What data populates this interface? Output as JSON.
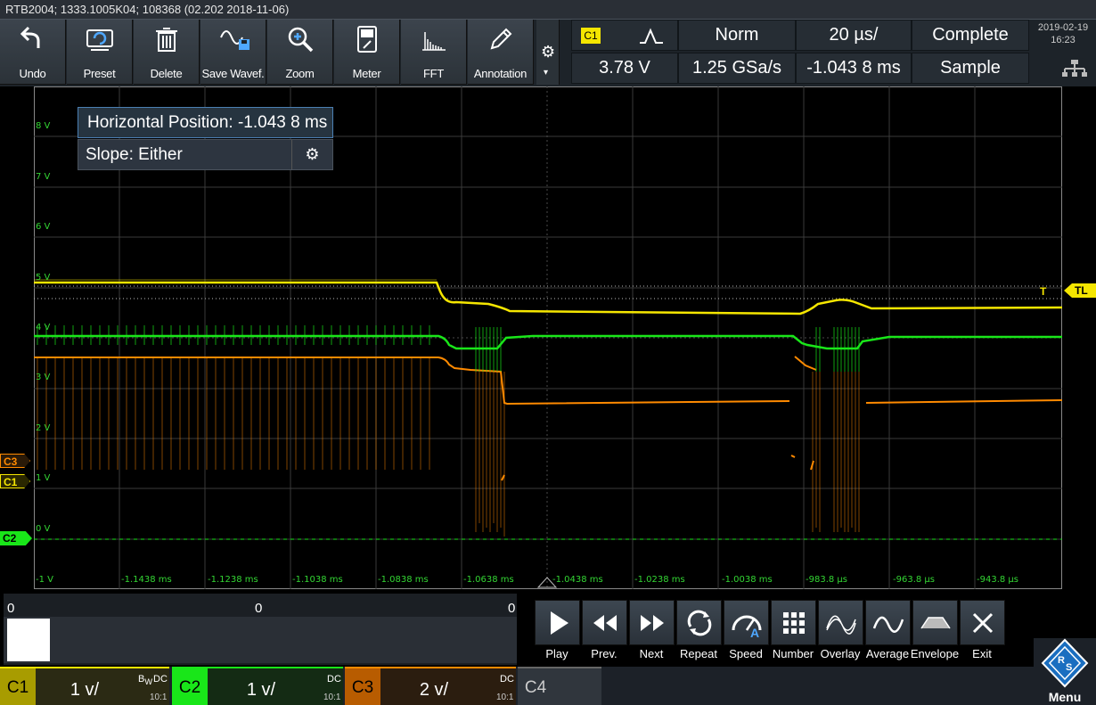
{
  "title": "RTB2004; 1333.1005K04; 108368 (02.202 2018-11-06)",
  "toolbar": {
    "buttons": [
      {
        "label": "Undo",
        "icon": "undo-icon"
      },
      {
        "label": "Preset",
        "icon": "preset-icon"
      },
      {
        "label": "Delete",
        "icon": "trash-icon"
      },
      {
        "label": "Save Wavef.",
        "icon": "save-waveform-icon"
      },
      {
        "label": "Zoom",
        "icon": "zoom-icon"
      },
      {
        "label": "Meter",
        "icon": "meter-icon"
      },
      {
        "label": "FFT",
        "icon": "fft-icon"
      },
      {
        "label": "Annotation",
        "icon": "pencil-icon"
      }
    ]
  },
  "trigger": {
    "source": "C1",
    "edge_icon": "edge-either-icon",
    "level": "3.78 V",
    "mode": "Norm",
    "sample_rate": "1.25 GSa/s",
    "timebase": "20 µs/",
    "horizontal_position": "-1.043 8 ms",
    "acquisition_state": "Complete",
    "acquisition_mode": "Sample"
  },
  "datetime": {
    "date": "2019-02-19",
    "time": "16:23"
  },
  "popup": {
    "horizontal_position": "Horizontal Position: -1.043 8 ms",
    "slope": "Slope: Either"
  },
  "y_axis_labels": [
    "8 V",
    "7 V",
    "6 V",
    "5 V",
    "4 V",
    "3 V",
    "2 V",
    "1 V",
    "0 V",
    "-1 V"
  ],
  "x_axis_labels": [
    "-1.1438 ms",
    "-1.1238 ms",
    "-1.1038 ms",
    "-1.0838 ms",
    "-1.0638 ms",
    "-1.0438 ms",
    "-1.0238 ms",
    "-1.0038 ms",
    "-983.8 µs",
    "-963.8 µs",
    "-943.8 µs"
  ],
  "markers": {
    "c3": "C3",
    "c1": "C1",
    "c2": "C2",
    "tl": "TL",
    "t": "T"
  },
  "segments": {
    "left": "0",
    "mid": "0",
    "right": "0"
  },
  "playback": [
    {
      "label": "Play",
      "icon": "play-icon"
    },
    {
      "label": "Prev.",
      "icon": "previous-icon"
    },
    {
      "label": "Next",
      "icon": "next-icon"
    },
    {
      "label": "Repeat",
      "icon": "repeat-icon"
    },
    {
      "label": "Speed",
      "icon": "speed-icon"
    },
    {
      "label": "Number",
      "icon": "number-grid-icon"
    },
    {
      "label": "Overlay",
      "icon": "overlay-icon"
    },
    {
      "label": "Average",
      "icon": "average-icon"
    },
    {
      "label": "Envelope",
      "icon": "envelope-icon"
    },
    {
      "label": "Exit",
      "icon": "close-icon"
    }
  ],
  "channels": [
    {
      "name": "C1",
      "scale": "1 v/",
      "coupling": "DC",
      "bw": "B",
      "bw_sub": "W",
      "ratio": "10:1",
      "color": "#f5e600"
    },
    {
      "name": "C2",
      "scale": "1 v/",
      "coupling": "DC",
      "ratio": "10:1",
      "color": "#19e619"
    },
    {
      "name": "C3",
      "scale": "2 v/",
      "coupling": "DC",
      "ratio": "10:1",
      "color": "#ff8a00"
    },
    {
      "name": "C4"
    }
  ],
  "menu": {
    "label": "Menu"
  },
  "colors": {
    "c1": "#f5e600",
    "c2": "#19e619",
    "c3": "#ff8a00",
    "accent": "#4b7fb3"
  }
}
